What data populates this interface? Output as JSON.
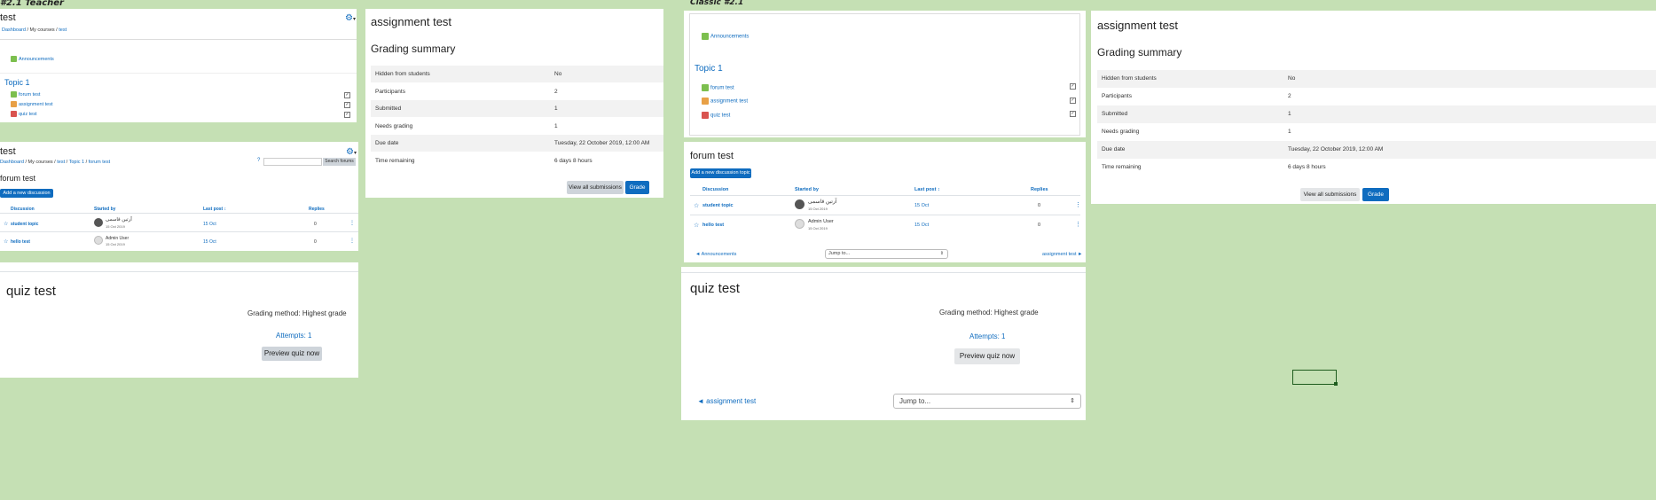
{
  "left": {
    "label": "#2.1 Teacher",
    "course": {
      "title": "test",
      "breadcrumb": [
        "Dashboard",
        "My courses",
        "test"
      ],
      "announcements": "Announcements",
      "topic": "Topic 1",
      "activities": [
        "forum test",
        "assignment test",
        "quiz test"
      ]
    },
    "forum": {
      "page_title": "test",
      "breadcrumb": [
        "Dashboard",
        "My courses",
        "test",
        "Topic 1",
        "forum test"
      ],
      "search_button": "Search forums",
      "heading": "forum test",
      "add_button": "Add a new discussion topic",
      "columns": [
        "Discussion",
        "Started by",
        "Last post",
        "Replies"
      ],
      "rows": [
        {
          "topic": "student topic",
          "author": "آرتین قاسمی",
          "date": "15 Oct 2019",
          "last": "15 Oct",
          "replies": "0"
        },
        {
          "topic": "hello test",
          "author": "Admin User",
          "date": "15 Oct 2019",
          "last": "15 Oct",
          "replies": "0"
        }
      ]
    },
    "quiz": {
      "title": "quiz test",
      "grading": "Grading method: Highest grade",
      "attempts": "Attempts: 1",
      "preview": "Preview quiz now"
    },
    "assign": {
      "title": "assignment test",
      "summary": "Grading summary",
      "rows": [
        {
          "k": "Hidden from students",
          "v": "No"
        },
        {
          "k": "Participants",
          "v": "2"
        },
        {
          "k": "Submitted",
          "v": "1"
        },
        {
          "k": "Needs grading",
          "v": "1"
        },
        {
          "k": "Due date",
          "v": "Tuesday, 22 October 2019, 12:00 AM"
        },
        {
          "k": "Time remaining",
          "v": "6 days 8 hours"
        }
      ],
      "view_all": "View all submissions",
      "grade": "Grade"
    }
  },
  "right": {
    "label": "Classic #2.1",
    "course": {
      "announcements": "Announcements",
      "topic": "Topic 1",
      "activities": [
        "forum test",
        "assignment test",
        "quiz test"
      ]
    },
    "forum": {
      "heading": "forum test",
      "add_button": "Add a new discussion topic",
      "columns": [
        "Discussion",
        "Started by",
        "Last post",
        "Replies"
      ],
      "rows": [
        {
          "topic": "student topic",
          "author": "آرتین قاسمی",
          "date": "15 Oct 2019",
          "last": "15 Oct",
          "replies": "0"
        },
        {
          "topic": "hello test",
          "author": "Admin User",
          "date": "15 Oct 2019",
          "last": "15 Oct",
          "replies": "0"
        }
      ],
      "prev": "◄ Announcements",
      "jump": "Jump to...",
      "next": "assignment test ►"
    },
    "quiz": {
      "title": "quiz test",
      "grading": "Grading method: Highest grade",
      "attempts": "Attempts: 1",
      "preview": "Preview quiz now",
      "prev": "◄ assignment test",
      "jump": "Jump to..."
    },
    "assign": {
      "title": "assignment test",
      "summary": "Grading summary",
      "rows": [
        {
          "k": "Hidden from students",
          "v": "No"
        },
        {
          "k": "Participants",
          "v": "2"
        },
        {
          "k": "Submitted",
          "v": "1"
        },
        {
          "k": "Needs grading",
          "v": "1"
        },
        {
          "k": "Due date",
          "v": "Tuesday, 22 October 2019, 12:00 AM"
        },
        {
          "k": "Time remaining",
          "v": "6 days 8 hours"
        }
      ],
      "view_all": "View all submissions",
      "grade": "Grade"
    }
  },
  "colors": {
    "background": "#c5e0b4",
    "accent": "#0f6cbf",
    "button_grey": "#ced4da"
  }
}
